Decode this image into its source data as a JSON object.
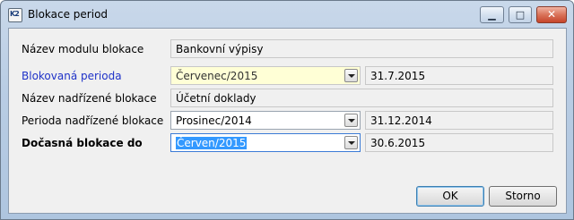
{
  "window": {
    "title": "Blokace period",
    "app_icon_text": "K2",
    "buttons": {
      "minimize_icon": "minimize-icon",
      "maximize_icon": "maximize-icon",
      "close_icon": "close-icon"
    }
  },
  "form": {
    "rows": [
      {
        "label": "Název modulu blokace",
        "value": "Bankovní výpisy"
      },
      {
        "label": "Blokovaná perioda",
        "value": "Červenec/2015",
        "date": "31.7.2015"
      },
      {
        "label": "Název nadřízené blokace",
        "value": "Účetní doklady"
      },
      {
        "label": "Perioda nadřízené blokace",
        "value": "Prosinec/2014",
        "date": "31.12.2014"
      },
      {
        "label": "Dočasná blokace do",
        "value": "Červen/2015",
        "date": "30.6.2015"
      }
    ]
  },
  "footer": {
    "ok_label": "OK",
    "cancel_label": "Storno"
  },
  "colors": {
    "blue_label": "#1f32c8",
    "selection": "#3399ff",
    "highlight_field": "#ffffd6"
  }
}
